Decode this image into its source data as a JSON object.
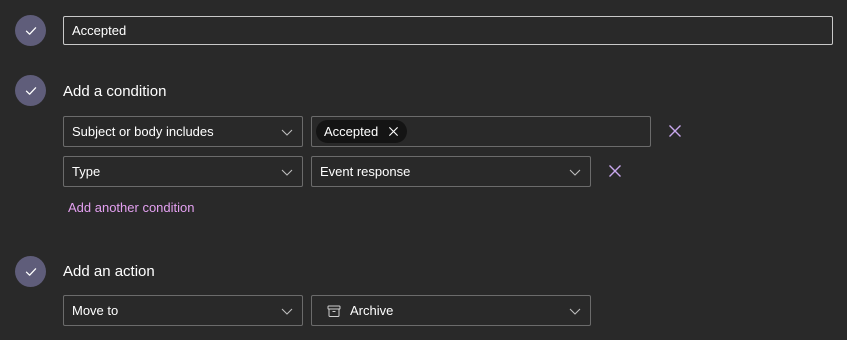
{
  "rule_name": {
    "value": "Accepted"
  },
  "conditions": {
    "title": "Add a condition",
    "rows": [
      {
        "field": "Subject or body includes",
        "tags": [
          "Accepted"
        ]
      },
      {
        "field": "Type",
        "value": "Event response"
      }
    ],
    "add_link": "Add another condition"
  },
  "actions": {
    "title": "Add an action",
    "rows": [
      {
        "action": "Move to",
        "folder": "Archive",
        "folder_icon": "archive-icon"
      }
    ]
  },
  "colors": {
    "background": "#292929",
    "step_circle": "#5f5d7a",
    "link": "#e3a0f0",
    "remove_icon": "#c9a8ee",
    "field_border": "#6b6b6b",
    "name_border": "#c8c8c8"
  }
}
